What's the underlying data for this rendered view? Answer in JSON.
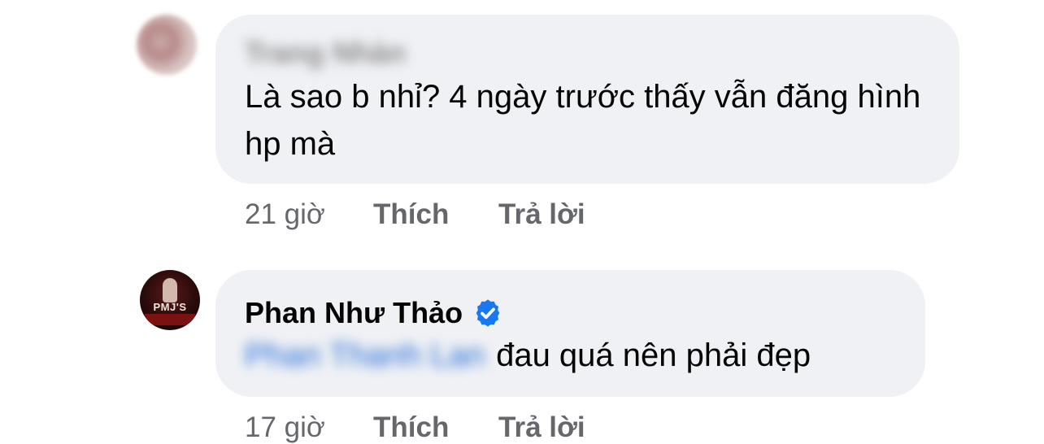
{
  "comments": [
    {
      "author": "Trang Nhàn",
      "author_blurred": true,
      "text": "Là sao b nhỉ? 4 ngày trước thấy vẫn đăng hình hp mà",
      "time": "21 giờ",
      "like_label": "Thích",
      "reply_label": "Trả lời"
    },
    {
      "author": "Phan Như Thảo",
      "verified": true,
      "mention": "Phan Thanh Lan",
      "mention_blurred": true,
      "text": "đau quá nên phải đẹp",
      "avatar_text": "PMJ'S",
      "time": "17 giờ",
      "like_label": "Thích",
      "reply_label": "Trả lời"
    }
  ],
  "colors": {
    "bubble": "#f0f1f5",
    "meta_text": "#65676b",
    "verified_badge": "#1877f2",
    "text": "#050505"
  }
}
